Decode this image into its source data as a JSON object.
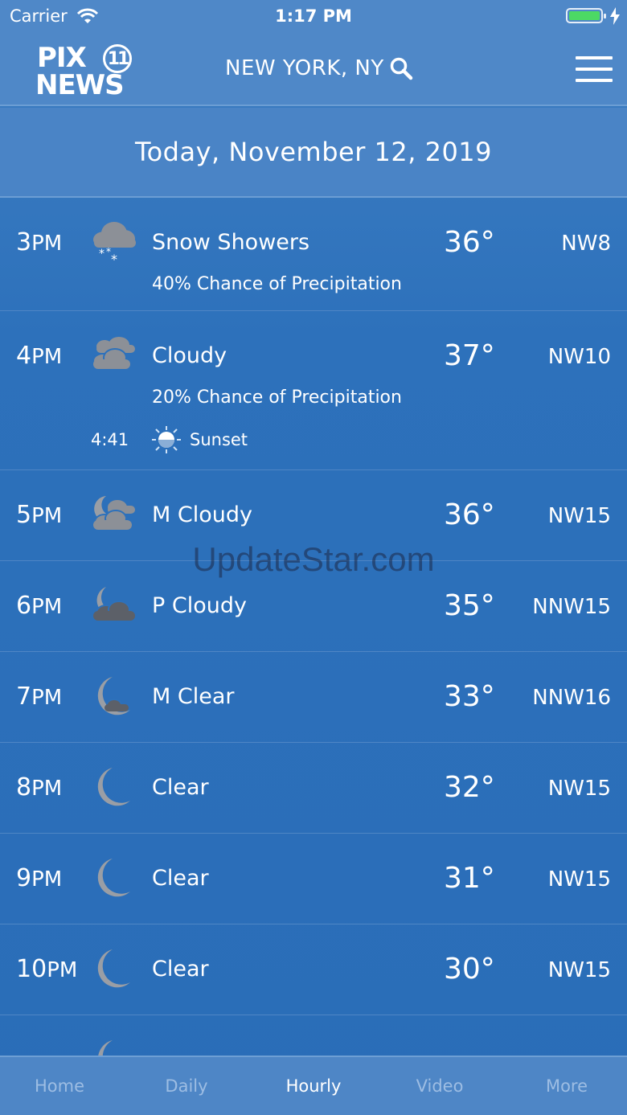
{
  "status_bar": {
    "carrier": "Carrier",
    "time": "1:17 PM"
  },
  "header": {
    "logo_top": "PIX",
    "logo_channel": "11",
    "logo_bottom": "NEWS",
    "location": "NEW YORK, NY"
  },
  "date_banner": "Today, November 12, 2019",
  "hours": [
    {
      "hour": "3",
      "ampm": "PM",
      "icon": "snow-showers-icon",
      "condition": "Snow Showers",
      "precip": "40% Chance of Precipitation",
      "temp": "36°",
      "wind": "NW8"
    },
    {
      "hour": "4",
      "ampm": "PM",
      "icon": "cloudy-icon",
      "condition": "Cloudy",
      "precip": "20% Chance of Precipitation",
      "temp": "37°",
      "wind": "NW10",
      "event_time": "4:41",
      "event_label": "Sunset"
    },
    {
      "hour": "5",
      "ampm": "PM",
      "icon": "mostly-cloudy-night-icon",
      "condition": "M Cloudy",
      "temp": "36°",
      "wind": "NW15"
    },
    {
      "hour": "6",
      "ampm": "PM",
      "icon": "partly-cloudy-night-icon",
      "condition": "P Cloudy",
      "temp": "35°",
      "wind": "NNW15"
    },
    {
      "hour": "7",
      "ampm": "PM",
      "icon": "mostly-clear-night-icon",
      "condition": "M Clear",
      "temp": "33°",
      "wind": "NNW16"
    },
    {
      "hour": "8",
      "ampm": "PM",
      "icon": "moon-icon",
      "condition": "Clear",
      "temp": "32°",
      "wind": "NW15"
    },
    {
      "hour": "9",
      "ampm": "PM",
      "icon": "moon-icon",
      "condition": "Clear",
      "temp": "31°",
      "wind": "NW15"
    },
    {
      "hour": "10",
      "ampm": "PM",
      "icon": "moon-icon",
      "condition": "Clear",
      "temp": "30°",
      "wind": "NW15"
    }
  ],
  "watermark": "UpdateStar.com",
  "tabs": [
    {
      "label": "Home"
    },
    {
      "label": "Daily"
    },
    {
      "label": "Hourly"
    },
    {
      "label": "Video"
    },
    {
      "label": "More"
    }
  ],
  "colors": {
    "background": "#2a6eb8",
    "header": "#4f88c8",
    "active_tab": "#ffffff",
    "inactive_tab": "#9dbde3",
    "icon_gray": "#8c9097"
  }
}
